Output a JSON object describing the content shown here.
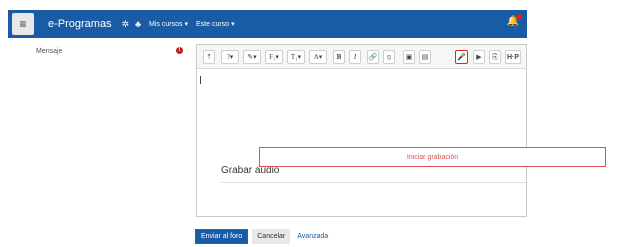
{
  "navbar": {
    "brand": "e-Programas",
    "menu_mis_cursos": "Mis cursos",
    "menu_este_curso": "Este curso"
  },
  "form": {
    "label_mensaje": "Mensaje",
    "required_mark": "!"
  },
  "toolbar": {
    "buttons": [
      "⤒",
      "?▾",
      "✎▾",
      "F₁▾",
      "T₁▾",
      "A▾",
      "B",
      "I",
      "🔗",
      "⦸",
      "▣",
      "▤",
      "🎤",
      "▶",
      "⎘",
      "H·P"
    ]
  },
  "recorder": {
    "title": "Grabar audio",
    "start_label": "Iniciar grabación"
  },
  "actions": {
    "submit": "Enviar al foro",
    "cancel": "Cancelar",
    "advanced": "Avanzada"
  },
  "colors": {
    "navbar": "#1a5ba6",
    "highlight": "#e2231a",
    "record_btn": "#d9534f"
  }
}
